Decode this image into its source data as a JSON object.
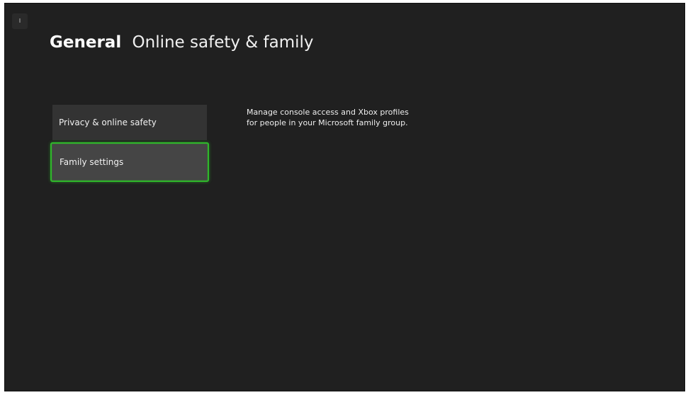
{
  "header": {
    "section": "General",
    "page": "Online safety & family"
  },
  "menu": {
    "items": [
      {
        "label": "Privacy & online safety",
        "focused": false
      },
      {
        "label": "Family settings",
        "focused": true
      }
    ]
  },
  "description": "Manage console access and Xbox profiles for people in your Microsoft family group.",
  "colors": {
    "background": "#202020",
    "menu_item": "#333333",
    "menu_item_focused": "#454545",
    "focus_ring": "#2fb82a"
  },
  "icons": {
    "corner_tab": "guide-tab-icon"
  }
}
